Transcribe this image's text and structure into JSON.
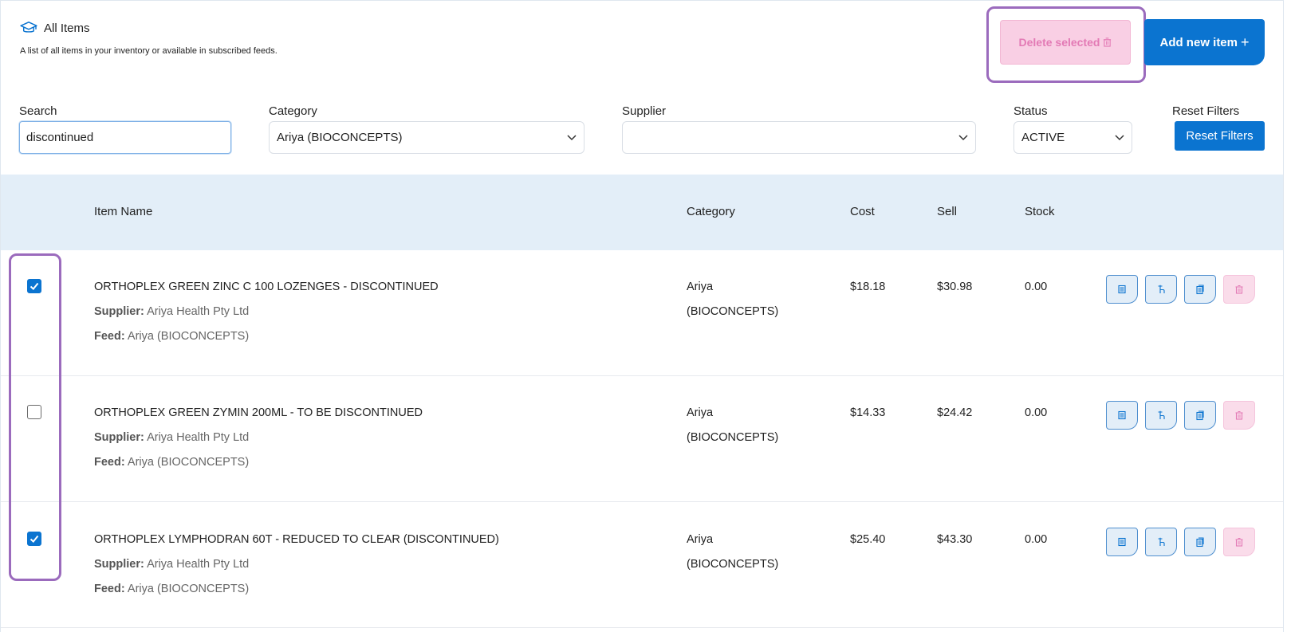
{
  "header": {
    "title": "All Items",
    "subtitle": "A list of all items in your inventory or available in subscribed feeds.",
    "delete_label": "Delete selected",
    "add_label": "Add new item",
    "add_plus": "+"
  },
  "filters": {
    "search_label": "Search",
    "search_value": "discontinued",
    "category_label": "Category",
    "category_value": "Ariya (BIOCONCEPTS)",
    "supplier_label": "Supplier",
    "supplier_value": "",
    "status_label": "Status",
    "status_value": "ACTIVE",
    "reset_label": "Reset Filters",
    "reset_button": "Reset Filters"
  },
  "table": {
    "columns": {
      "name": "Item Name",
      "category": "Category",
      "cost": "Cost",
      "sell": "Sell",
      "stock": "Stock"
    },
    "rows": [
      {
        "checked": true,
        "name": "ORTHOPLEX GREEN ZINC C 100 LOZENGES - DISCONTINUED",
        "supplier_label": "Supplier:",
        "supplier": "Ariya Health Pty Ltd",
        "feed_label": "Feed:",
        "feed": "Ariya (BIOCONCEPTS)",
        "category_line1": "Ariya",
        "category_line2": "(BIOCONCEPTS)",
        "cost": "$18.18",
        "sell": "$30.98",
        "stock": "0.00"
      },
      {
        "checked": false,
        "name": "ORTHOPLEX GREEN ZYMIN 200ML - TO BE DISCONTINUED",
        "supplier_label": "Supplier:",
        "supplier": "Ariya Health Pty Ltd",
        "feed_label": "Feed:",
        "feed": "Ariya (BIOCONCEPTS)",
        "category_line1": "Ariya",
        "category_line2": "(BIOCONCEPTS)",
        "cost": "$14.33",
        "sell": "$24.42",
        "stock": "0.00"
      },
      {
        "checked": true,
        "name": "ORTHOPLEX LYMPHODRAN 60T - REDUCED TO CLEAR (DISCONTINUED)",
        "supplier_label": "Supplier:",
        "supplier": "Ariya Health Pty Ltd",
        "feed_label": "Feed:",
        "feed": "Ariya (BIOCONCEPTS)",
        "category_line1": "Ariya",
        "category_line2": "(BIOCONCEPTS)",
        "cost": "$25.40",
        "sell": "$43.30",
        "stock": "0.00"
      }
    ]
  },
  "icons": {
    "title": "graduation-cap-icon",
    "delete": "trash-icon",
    "row_actions": [
      "details-icon",
      "touch-icon",
      "copy-icon",
      "trash-icon"
    ]
  },
  "colors": {
    "primary": "#0b74d0",
    "danger_light": "#f9cfe4",
    "danger_text": "#e37ab5",
    "header_bg": "#e3eef8",
    "highlight": "#9b6bbd"
  }
}
